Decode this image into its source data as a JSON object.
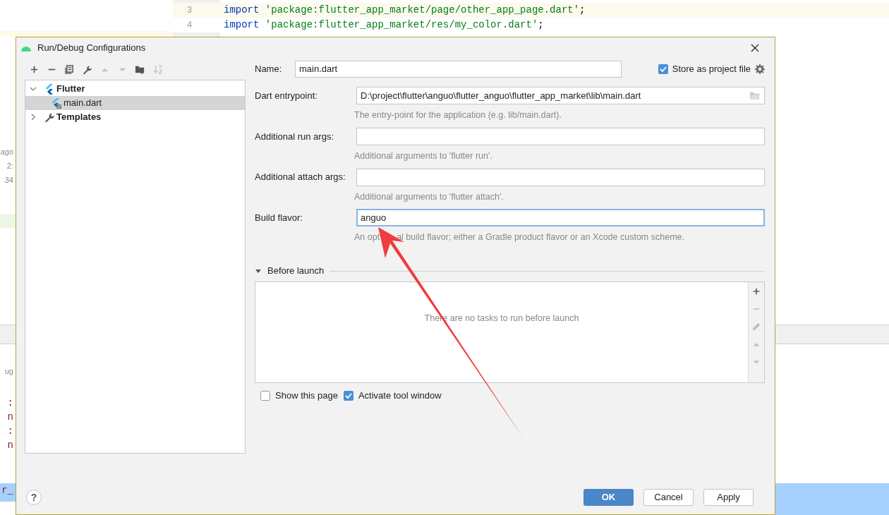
{
  "editor": {
    "lines": [
      {
        "number": "3",
        "keyword": "import",
        "text": "'package:flutter_app_market/page/other_app_page.dart'",
        "end": ";",
        "current": true
      },
      {
        "number": "4",
        "keyword": "import",
        "text": "'package:flutter_app_market/res/my_color.dart'",
        "end": ";",
        "current": false
      }
    ]
  },
  "background_fragments": [
    {
      "kind": "log",
      "text": "ago"
    },
    {
      "kind": "log",
      "text": "2:"
    },
    {
      "kind": "log",
      "text": "34"
    },
    {
      "kind": "log",
      "text": "ug"
    },
    {
      "kind": "code",
      "text": ":"
    },
    {
      "kind": "code",
      "text": "n"
    },
    {
      "kind": "code",
      "text": ":"
    },
    {
      "kind": "code",
      "text": "n"
    },
    {
      "kind": "code",
      "text": "r_"
    }
  ],
  "dialog": {
    "title": "Run/Debug Configurations",
    "toolbar": [
      {
        "kind": "add",
        "disabled": false
      },
      {
        "kind": "remove",
        "disabled": false
      },
      {
        "kind": "copy",
        "disabled": false
      },
      {
        "kind": "wrench",
        "disabled": false
      },
      {
        "kind": "up",
        "disabled": true
      },
      {
        "kind": "down",
        "disabled": true
      },
      {
        "kind": "folder",
        "disabled": false
      },
      {
        "kind": "sort",
        "disabled": true
      }
    ],
    "tree": [
      {
        "label": "Flutter",
        "kind": "flutter",
        "expanded": true,
        "selected": false,
        "children": [
          {
            "label": "main.dart",
            "kind": "config",
            "selected": true
          }
        ]
      },
      {
        "label": "Templates",
        "kind": "wrench",
        "expanded": false,
        "selected": false
      }
    ],
    "name": {
      "label": "Name:",
      "value": "main.dart"
    },
    "store_as_project_file": {
      "label": "Store as project file",
      "checked": true
    },
    "fields": [
      {
        "label": "Dart entrypoint:",
        "value": "D:\\project\\flutter\\anguo\\flutter_anguo\\flutter_app_market\\lib\\main.dart",
        "browse": true,
        "focused": false,
        "hint_parts": [
          "The entry-point for the application (e.g. lib/main.dart)."
        ]
      },
      {
        "label": "Additional run args:",
        "focused": false,
        "hint_parts": [
          "Additional arguments to 'flutter run'."
        ]
      },
      {
        "label": "Additional attach args:",
        "focused": false,
        "hint_parts": [
          "Additional arguments to 'flutter attach'."
        ]
      },
      {
        "label": "Build flavor:",
        "value": "anguo",
        "focused": true,
        "hint_parts": [
          "An opt",
          "al build flavor; either a Gradle product flavor or an Xcode custom scheme."
        ]
      }
    ],
    "before_launch": {
      "label": "Before launch",
      "expanded": true,
      "empty_text": "There are no tasks to run before launch",
      "toolbar": [
        {
          "kind": "add",
          "disabled": false
        },
        {
          "kind": "remove",
          "disabled": true
        },
        {
          "kind": "edit",
          "disabled": true
        },
        {
          "kind": "up",
          "disabled": true
        },
        {
          "kind": "down",
          "disabled": true
        }
      ]
    },
    "options": [
      {
        "label": "Show this page",
        "checked": false
      },
      {
        "label": "Activate tool window",
        "checked": true
      }
    ],
    "help_label": "?",
    "buttons": [
      {
        "label": "OK",
        "primary": true
      },
      {
        "label": "Cancel",
        "primary": false
      },
      {
        "label": "Apply",
        "primary": false
      }
    ]
  }
}
